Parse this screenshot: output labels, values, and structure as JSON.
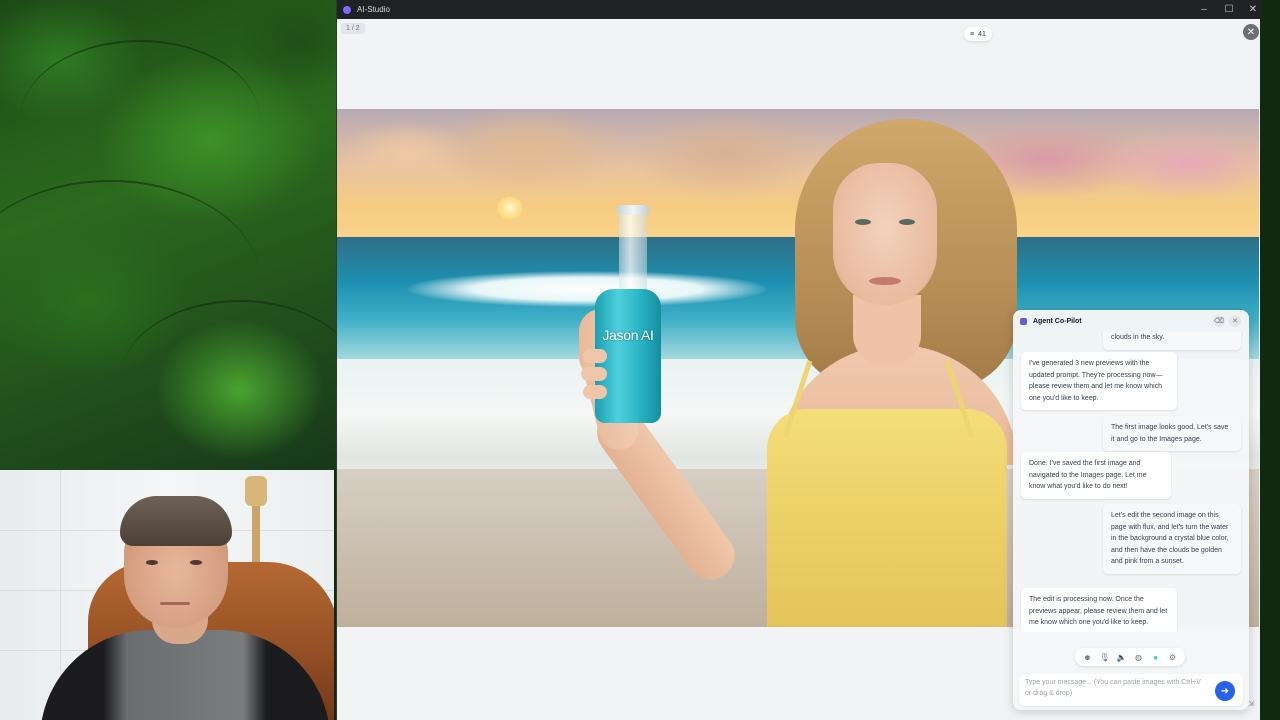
{
  "window": {
    "title": "AI-Studio",
    "controls": {
      "minimize": "–",
      "maximize": "☐",
      "close": "✕"
    }
  },
  "viewer": {
    "pager": "1 / 2",
    "counter_icon": "≡",
    "counter": "41",
    "close": "✕",
    "collapse_icon": "⇲"
  },
  "image": {
    "bottle_text": "Jason AI"
  },
  "copilot": {
    "title": "Agent Co-Pilot",
    "header_icons": {
      "clear": "⌫",
      "close": "✕"
    },
    "messages": [
      {
        "role": "user",
        "text": "clouds in the sky."
      },
      {
        "role": "assistant",
        "text": "I've generated 3 new previews with the updated prompt. They're processing now—please review them and let me know which one you'd like to keep."
      },
      {
        "role": "user",
        "text": "The first image looks good. Let's save it and go to the Images page."
      },
      {
        "role": "assistant",
        "text": "Done. I've saved the first image and navigated to the Images page. Let me know what you'd like to do next!"
      },
      {
        "role": "user",
        "text": "Let's edit the second image on this page with flux, and let's turn the water in the background a crystal blue color, and then have the clouds be golden and pink from a sunset."
      },
      {
        "role": "assistant",
        "text": "The edit is processing now. Once the previews appear, please review them and let me know which one you'd like to keep."
      }
    ],
    "tools": [
      {
        "name": "chat-mode-icon",
        "glyph": "☻"
      },
      {
        "name": "microphone-icon",
        "glyph": "🎙"
      },
      {
        "name": "speaker-icon",
        "glyph": "🔈"
      },
      {
        "name": "globe-icon",
        "glyph": "◍"
      },
      {
        "name": "status-dot-icon",
        "glyph": "●"
      },
      {
        "name": "settings-icon",
        "glyph": "⚙"
      }
    ],
    "input": {
      "placeholder": "Type your message... (You can paste images with Ctrl+V or drag & drop)",
      "value": ""
    },
    "send_icon": "➜",
    "accent": "#2563eb"
  }
}
